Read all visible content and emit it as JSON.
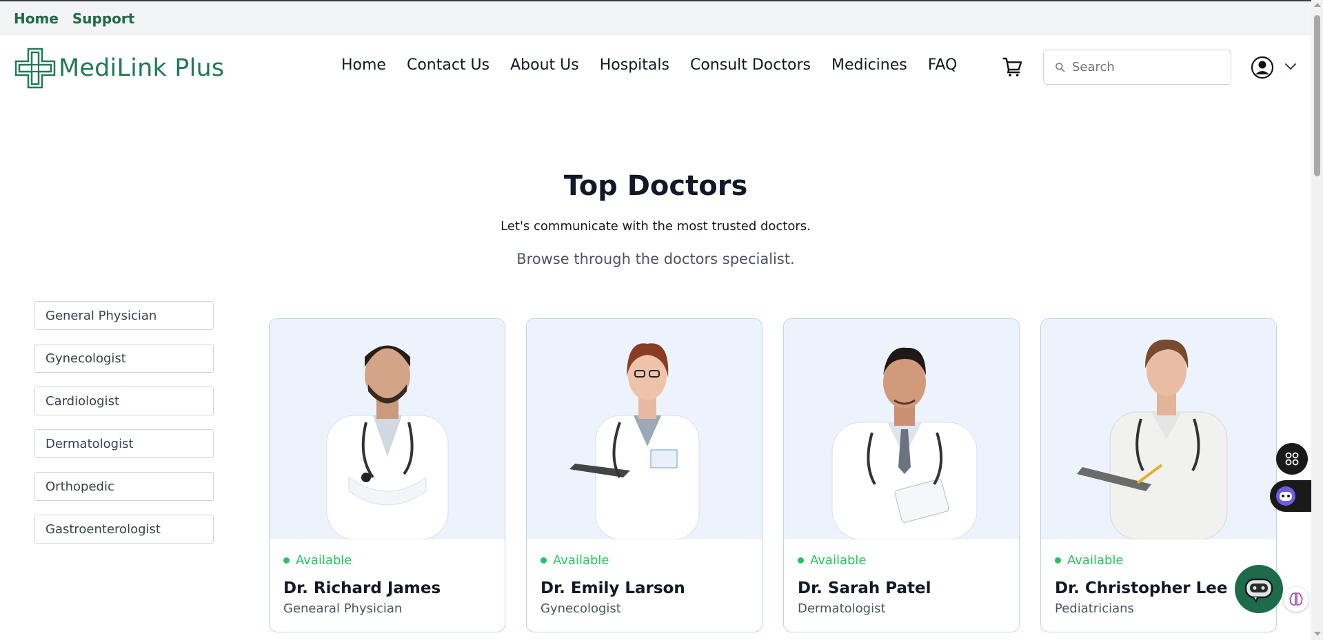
{
  "topbar": {
    "links": [
      "Home",
      "Support"
    ]
  },
  "header": {
    "brand": "MediLink Plus",
    "nav": [
      "Home",
      "Contact Us",
      "About Us",
      "Hospitals",
      "Consult Doctors",
      "Medicines",
      "FAQ"
    ],
    "search_placeholder": "Search",
    "icons": [
      "cart-icon",
      "search-icon",
      "user-avatar-icon",
      "chevron-down-icon"
    ]
  },
  "hero": {
    "title": "Top Doctors",
    "subtitle": "Let's communicate with the most trusted doctors.",
    "subtitle2": "Browse through the doctors specialist."
  },
  "filters": [
    "General Physician",
    "Gynecologist",
    "Cardiologist",
    "Dermatologist",
    "Orthopedic",
    "Gastroenterologist"
  ],
  "doctors": [
    {
      "status": "Available",
      "name": "Dr. Richard James",
      "specialty": "Genearal Physician"
    },
    {
      "status": "Available",
      "name": "Dr. Emily Larson",
      "specialty": "Gynecologist"
    },
    {
      "status": "Available",
      "name": "Dr. Sarah Patel",
      "specialty": "Dermatologist"
    },
    {
      "status": "Available",
      "name": "Dr. Christopher Lee",
      "specialty": "Pediatricians"
    }
  ],
  "colors": {
    "brand_green": "#1f7a55",
    "available_green": "#22c55e",
    "card_bg": "#edf3fd",
    "card_border": "#bcd3f0"
  },
  "widgets": [
    "apps-grid-icon",
    "bot-icon",
    "chat-bot-icon",
    "brain-icon"
  ]
}
